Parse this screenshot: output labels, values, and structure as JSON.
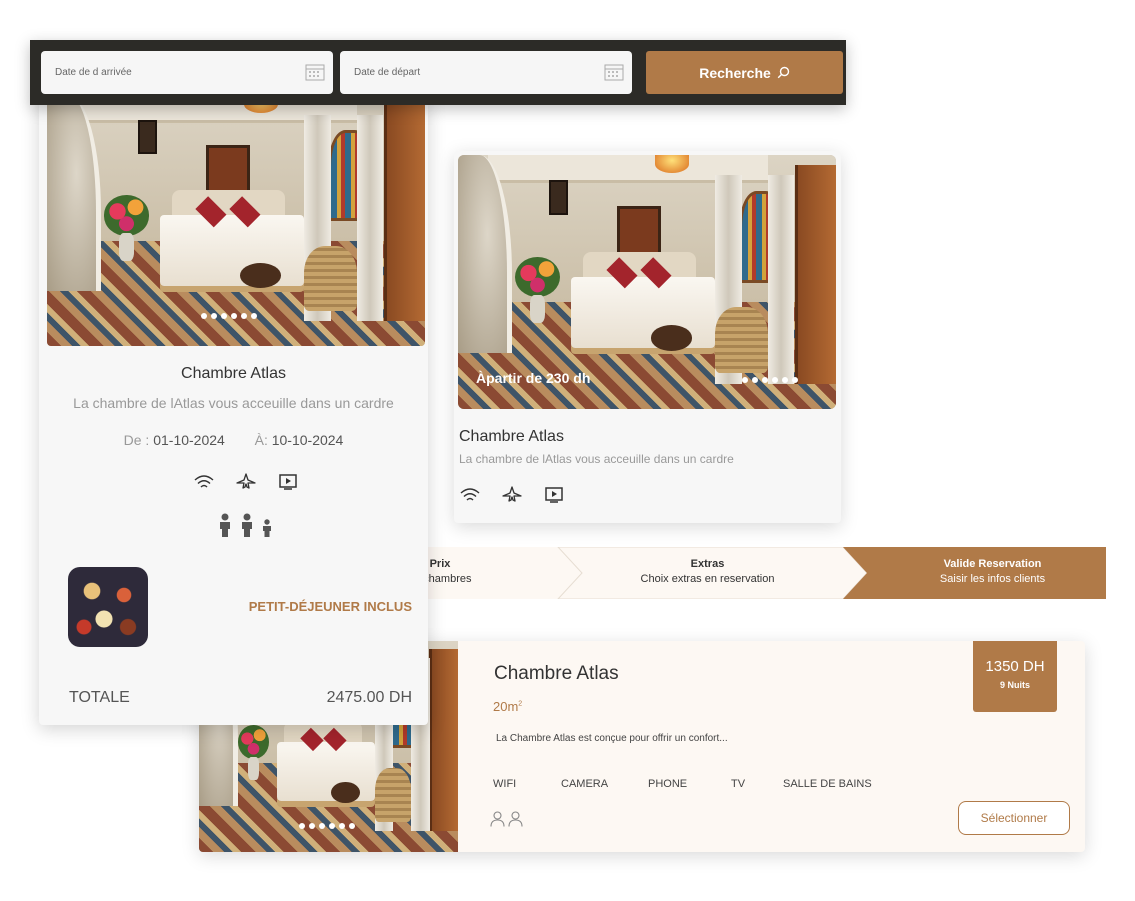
{
  "search": {
    "arrival_placeholder": "Date de d arrivée",
    "departure_placeholder": "Date de départ",
    "button_label": "Recherche"
  },
  "card_left": {
    "title": "Chambre Atlas",
    "description": "La chambre de lAtlas vous acceuille dans un cardre",
    "from_label": "De",
    "from_date": "01-10-2024",
    "to_label": "À:",
    "to_date": "10-10-2024",
    "breakfast": "PETIT-DÉJEUNER INCLUS",
    "total_label": "TOTALE",
    "total_value": "2475.00 DH",
    "amenity_icons": [
      "wifi-icon",
      "airplane-icon",
      "tv-icon"
    ],
    "guest_icons": [
      "adult-icon",
      "adult-icon",
      "child-icon"
    ]
  },
  "card_right": {
    "price_label": "Àpartir de 230 dh",
    "title": "Chambre Atlas",
    "description": "La chambre de lAtlas vous acceuille dans un cardre",
    "amenity_icons": [
      "wifi-icon",
      "airplane-icon",
      "tv-icon"
    ]
  },
  "steps": [
    {
      "title": "Prix",
      "subtitle": "rix chambres",
      "state": "done"
    },
    {
      "title": "Extras",
      "subtitle": "Choix extras en reservation",
      "state": "done"
    },
    {
      "title": "Valide Reservation",
      "subtitle": "Saisir les infos clients",
      "state": "active"
    }
  ],
  "card_bottom": {
    "title": "Chambre Atlas",
    "area": "20m",
    "area_sup": "2",
    "description": "La Chambre Atlas est conçue pour offrir un confort...",
    "amenities": [
      "WIFI",
      "CAMERA",
      "PHONE",
      "TV",
      "SALLE DE BAINS"
    ],
    "price": "1350 DH",
    "nights": "9 Nuits",
    "select_label": "Sélectionner"
  },
  "colors": {
    "accent": "#b07a48",
    "dark_bar": "#2c2b27",
    "card_bg": "#f7f7f7",
    "cream": "#fdf8f3"
  }
}
